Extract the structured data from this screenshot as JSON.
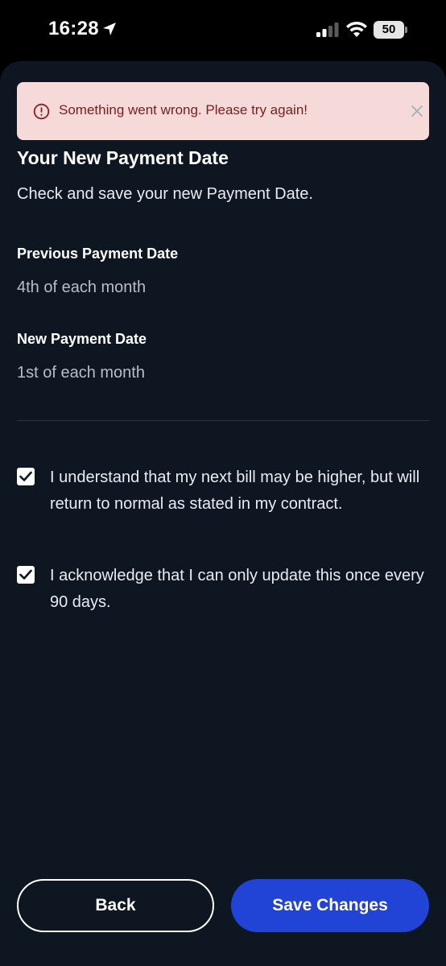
{
  "status_bar": {
    "time": "16:28",
    "battery": "50"
  },
  "toast": {
    "message": "Something went wrong. Please try again!",
    "icon": "alert-circle-icon",
    "close_icon": "close-icon",
    "bg_color": "#f6d9d9",
    "text_color": "#7a1d1d"
  },
  "page": {
    "title": "Your New Payment Date",
    "subtitle": "Check and save your new Payment Date."
  },
  "fields": {
    "previous": {
      "label": "Previous Payment Date",
      "value": "4th of each month"
    },
    "new": {
      "label": "New Payment Date",
      "value": "1st of each month"
    }
  },
  "checkboxes": [
    {
      "text": "I understand that my next bill may be higher, but will return to normal as stated in my contract.",
      "checked": true
    },
    {
      "text": "I acknowledge that I can only update this once every 90 days.",
      "checked": true
    }
  ],
  "buttons": {
    "back": "Back",
    "save": "Save Changes"
  },
  "colors": {
    "background": "#0e1622",
    "accent": "#2143d6"
  }
}
